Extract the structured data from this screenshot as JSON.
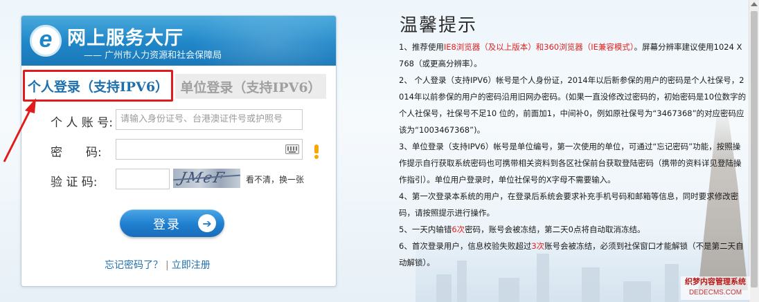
{
  "header": {
    "logo_letter": "e",
    "title": "网上服务大厅",
    "subtitle": "—— 广州市人力资源和社会保障局"
  },
  "tabs": {
    "personal": "个人登录（支持IPV6）",
    "unit": "单位登录（支持IPV6）"
  },
  "form": {
    "account_label": "个 人 账 号:",
    "account_placeholder": "请输入身份证号、台港澳证件号或护照号",
    "password_label": "密　　码:",
    "captcha_label": "验 证 码:",
    "captcha_text": "JMeF",
    "captcha_refresh": "看不清，换一张",
    "login_button": "登录",
    "forgot_password": "忘记密码了？",
    "separator": "|",
    "register": "立即注册"
  },
  "tips": {
    "title": "温馨提示",
    "items": [
      {
        "pre": "1、推荐使用",
        "red": "IE8浏览器（及以上版本）和360浏览器（IE兼容模式）",
        "post": "。屏幕分辨率建议使用1024 X 768（或更高分辨率）。"
      },
      {
        "pre": "2、 个人登录（支持IPV6）帐号是个人身份证，2014年以后新参保的用户的密码是个人社保号，2014年以前参保的用户的密码沿用旧网办密码。(如果一直没修改过密码的，初始密码是10位数字的个人社保号，社保号不足10 位的，前面加1，中间补0，例如原社保号为“3467368”的对应密码应该为“1003467368”)。",
        "red": "",
        "post": ""
      },
      {
        "pre": "3、单位登录（支持IPV6）帐号是单位编号，第一次使用的单位，可通过“忘记密码”功能，按照操作提示自行获取系统密码也可携带相关资料到各区社保前台获取登陆密码（携带的资料详见登陆操作指引）。单位用户登录时，单位社保号的X字母不需要输入。",
        "red": "",
        "post": ""
      },
      {
        "pre": "4、第一次登录本系统的用户，在登录后系统会要求补充手机号码和邮箱等信息，同时要求修改密码，请按照提示进行操作。",
        "red": "",
        "post": ""
      },
      {
        "pre": "5、一天内输错",
        "red": "6次",
        "post": "密码，账号会被冻结，第二天0点将自动取消冻结。"
      },
      {
        "pre": "6、首次登录用户，信息校验失败超过",
        "red": "3次",
        "post": "账号会被冻结，必须到社保窗口才能解锁（不是第二天自动解锁）。"
      }
    ]
  },
  "watermark": {
    "line1": "织梦内容管理系统",
    "line2": "DEDECMS.COM"
  },
  "colors": {
    "banner_blue": "#1f86c8",
    "highlight_red": "#e11b1b",
    "link_blue": "#1e6fae",
    "warning_orange": "#f5a800"
  },
  "icons": [
    "keyboard-icon",
    "warning-icon",
    "arrow-right-icon",
    "red-pointer-arrow-icon"
  ]
}
